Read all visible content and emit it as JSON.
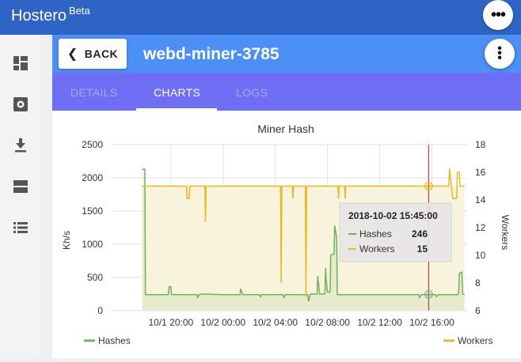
{
  "app": {
    "title": "Hostero",
    "badge": "Beta"
  },
  "header": {
    "back_label": "BACK",
    "title": "webd-miner-3785"
  },
  "sidebar": {
    "items": [
      {
        "icon": "dashboard-icon"
      },
      {
        "icon": "settings-icon"
      },
      {
        "icon": "download-icon"
      },
      {
        "icon": "storage-icon"
      },
      {
        "icon": "list-icon"
      }
    ]
  },
  "tabs": [
    {
      "label": "DETAILS",
      "active": false
    },
    {
      "label": "CHARTS",
      "active": true
    },
    {
      "label": "LOGS",
      "active": false
    }
  ],
  "colors": {
    "topbar": "#2f64c7",
    "header": "#4c8ff6",
    "tabs": "#6e6ff4",
    "hashes": "#6db35c",
    "workers": "#e8b920",
    "cursor": "#b22222"
  },
  "chart_data": {
    "type": "line",
    "title": "Miner Hash",
    "ylabel": "Kh/s",
    "y2label": "Workers",
    "ylim": [
      0,
      2500
    ],
    "y2lim": [
      6,
      18
    ],
    "yticks": [
      "0",
      "500",
      "1000",
      "1500",
      "2000",
      "2500"
    ],
    "y2ticks": [
      "6",
      "8",
      "10",
      "12",
      "14",
      "16",
      "18"
    ],
    "xticks": [
      "10/1 20:00",
      "10/2 00:00",
      "10/2 04:00",
      "10/2 08:00",
      "10/2 12:00",
      "10/2 16:00"
    ],
    "legend": [
      "Hashes",
      "Workers"
    ],
    "legend_placement": "bottom",
    "series": [
      {
        "name": "Hashes",
        "axis": "left",
        "color": "#6db35c",
        "points": [
          [
            17.8,
            2130
          ],
          [
            18.0,
            2130
          ],
          [
            18.05,
            240
          ],
          [
            19.8,
            240
          ],
          [
            19.85,
            360
          ],
          [
            20.0,
            360
          ],
          [
            20.05,
            240
          ],
          [
            22.0,
            240
          ],
          [
            22.05,
            200
          ],
          [
            22.2,
            250
          ],
          [
            24.0,
            240
          ],
          [
            25.3,
            240
          ],
          [
            25.35,
            330
          ],
          [
            25.5,
            240
          ],
          [
            26.8,
            240
          ],
          [
            26.85,
            210
          ],
          [
            27.0,
            240
          ],
          [
            28.6,
            240
          ],
          [
            28.65,
            200
          ],
          [
            28.8,
            240
          ],
          [
            30.5,
            240
          ],
          [
            30.55,
            140
          ],
          [
            30.7,
            250
          ],
          [
            31.2,
            250
          ],
          [
            31.25,
            520
          ],
          [
            31.4,
            250
          ],
          [
            31.8,
            250
          ],
          [
            31.85,
            640
          ],
          [
            31.9,
            470
          ],
          [
            32.0,
            280
          ],
          [
            32.2,
            280
          ],
          [
            32.25,
            840
          ],
          [
            32.5,
            850
          ],
          [
            32.55,
            1280
          ],
          [
            32.7,
            1100
          ],
          [
            32.75,
            240
          ],
          [
            34.0,
            240
          ],
          [
            35.0,
            240
          ],
          [
            36.0,
            240
          ],
          [
            37.0,
            240
          ],
          [
            38.0,
            240
          ],
          [
            39.0,
            240
          ],
          [
            39.05,
            200
          ],
          [
            39.2,
            240
          ],
          [
            40.3,
            240
          ],
          [
            40.35,
            210
          ],
          [
            40.5,
            240
          ],
          [
            42.0,
            240
          ],
          [
            42.05,
            270
          ],
          [
            42.1,
            560
          ],
          [
            42.3,
            580
          ],
          [
            42.35,
            250
          ],
          [
            42.5,
            240
          ]
        ]
      },
      {
        "name": "Workers",
        "axis": "right",
        "color": "#e8b920",
        "points": [
          [
            17.8,
            15
          ],
          [
            21.2,
            15
          ],
          [
            21.25,
            14.1
          ],
          [
            21.4,
            14.1
          ],
          [
            21.45,
            15
          ],
          [
            22.6,
            15
          ],
          [
            22.65,
            12.4
          ],
          [
            22.7,
            15
          ],
          [
            28.4,
            15
          ],
          [
            28.45,
            8
          ],
          [
            28.5,
            15
          ],
          [
            29.3,
            15
          ],
          [
            29.35,
            14.1
          ],
          [
            29.4,
            15
          ],
          [
            30.3,
            15
          ],
          [
            30.35,
            7
          ],
          [
            30.4,
            15
          ],
          [
            32.8,
            15
          ],
          [
            32.85,
            14.1
          ],
          [
            32.9,
            15
          ],
          [
            33.3,
            15
          ],
          [
            33.35,
            14.1
          ],
          [
            33.4,
            15
          ],
          [
            41.3,
            15
          ],
          [
            41.35,
            16.3
          ],
          [
            41.5,
            15
          ],
          [
            41.6,
            14.1
          ],
          [
            41.9,
            14.1
          ],
          [
            41.95,
            16
          ],
          [
            42.1,
            16
          ],
          [
            42.15,
            15
          ],
          [
            42.5,
            15
          ]
        ]
      }
    ],
    "tooltip": {
      "time": "2018-10-02 15:45:00",
      "rows": [
        {
          "name": "Hashes",
          "value": "246"
        },
        {
          "name": "Workers",
          "value": "15"
        }
      ]
    },
    "cursor_time": 39.75
  }
}
